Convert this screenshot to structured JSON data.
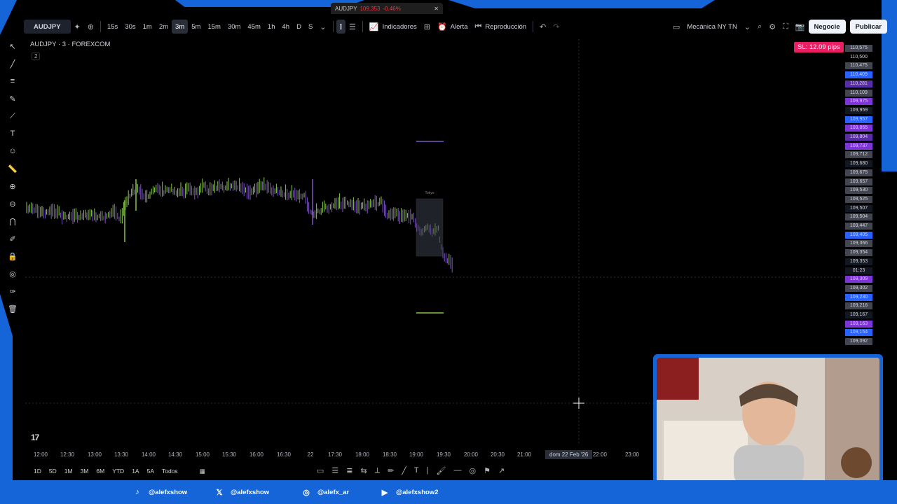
{
  "window_tab": {
    "symbol": "AUDJPY",
    "price": "109,353",
    "change": "-0.46%"
  },
  "toolbar": {
    "symbol": "AUDJPY",
    "intervals": [
      "15s",
      "30s",
      "1m",
      "2m",
      "3m",
      "5m",
      "15m",
      "30m",
      "45m",
      "1h",
      "4h",
      "D",
      "S"
    ],
    "active_interval": "3m",
    "indicators": "Indicadores",
    "alert": "Alerta",
    "replay": "Reproducción",
    "layout_name": "Mecánica NY TN",
    "trade": "Negocie",
    "publish": "Publicar"
  },
  "chart": {
    "title": "AUDJPY · 3 · FOREXCOM",
    "badge": "2",
    "sl_badge": "SL: 12.09 pips",
    "session_label": "Tokyo"
  },
  "price_scale": [
    {
      "v": "110,575",
      "c": "#434651"
    },
    {
      "v": "110,500",
      "c": ""
    },
    {
      "v": "110,475",
      "c": "#434651"
    },
    {
      "v": "110,409",
      "c": "#2962ff"
    },
    {
      "v": "110,281",
      "c": "#5b2ca8"
    },
    {
      "v": "110,109",
      "c": "#434651"
    },
    {
      "v": "109,975",
      "c": "#7e35d6"
    },
    {
      "v": "109,959",
      "c": "#131722"
    },
    {
      "v": "109,957",
      "c": "#2962ff"
    },
    {
      "v": "109,855",
      "c": "#7e35d6"
    },
    {
      "v": "109,804",
      "c": "#5b2ca8"
    },
    {
      "v": "109,737",
      "c": "#7e35d6"
    },
    {
      "v": "109,712",
      "c": "#434651"
    },
    {
      "v": "109,680",
      "c": "#131722"
    },
    {
      "v": "109,675",
      "c": "#434651"
    },
    {
      "v": "109,657",
      "c": "#434651"
    },
    {
      "v": "109,530",
      "c": "#434651"
    },
    {
      "v": "109,525",
      "c": "#434651"
    },
    {
      "v": "109,507",
      "c": "#131722"
    },
    {
      "v": "109,504",
      "c": "#434651"
    },
    {
      "v": "109,447",
      "c": "#434651"
    },
    {
      "v": "109,405",
      "c": "#2962ff"
    },
    {
      "v": "109,366",
      "c": "#434651"
    },
    {
      "v": "109,354",
      "c": "#434651"
    },
    {
      "v": "109,353",
      "c": "#131722"
    },
    {
      "v": "01:23",
      "c": "#131722"
    },
    {
      "v": "109,309",
      "c": "#7e35d6"
    },
    {
      "v": "109,302",
      "c": "#434651"
    },
    {
      "v": "109,230",
      "c": "#2962ff"
    },
    {
      "v": "109,216",
      "c": "#434651"
    },
    {
      "v": "109,167",
      "c": "#131722"
    },
    {
      "v": "109,163",
      "c": "#7e35d6"
    },
    {
      "v": "109,154",
      "c": "#2962ff"
    },
    {
      "v": "109,092",
      "c": "#434651"
    }
  ],
  "time_axis": [
    "12:00",
    "12:30",
    "13:00",
    "13:30",
    "14:00",
    "14:30",
    "15:00",
    "15:30",
    "16:00",
    "16:30",
    "22",
    "17:30",
    "18:00",
    "18:30",
    "19:00",
    "19:30",
    "20:00",
    "20:30",
    "21:00",
    "22:00",
    "23:00"
  ],
  "crosshair_time": "dom 22 Feb '26",
  "ranges": [
    "1D",
    "5D",
    "1M",
    "3M",
    "6M",
    "YTD",
    "1A",
    "5A",
    "Todos"
  ],
  "socials": [
    {
      "icon": "tiktok-icon",
      "handle": "@alefxshow"
    },
    {
      "icon": "x-icon",
      "handle": "@alefxshow"
    },
    {
      "icon": "instagram-icon",
      "handle": "@alefx_ar"
    },
    {
      "icon": "youtube-icon",
      "handle": "@alefxshow2"
    }
  ],
  "logo": "17"
}
